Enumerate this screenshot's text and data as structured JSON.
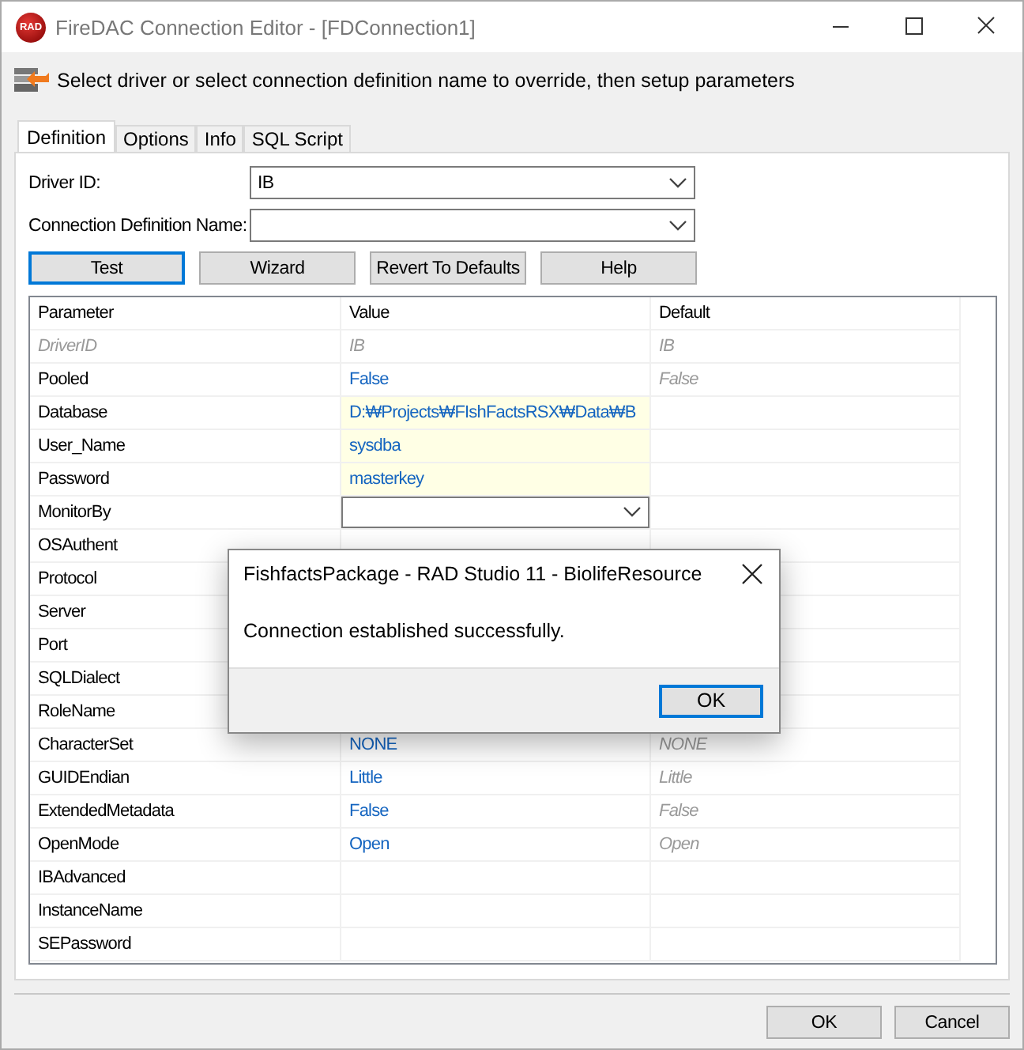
{
  "window": {
    "logo": "RAD",
    "title": "FireDAC Connection Editor - [FDConnection1]"
  },
  "header": {
    "text": "Select driver or select connection definition name to override, then setup parameters"
  },
  "tabs": [
    {
      "label": "Definition",
      "selected": true
    },
    {
      "label": "Options",
      "selected": false
    },
    {
      "label": "Info",
      "selected": false
    },
    {
      "label": "SQL Script",
      "selected": false
    }
  ],
  "fields": [
    {
      "label": "Driver ID:",
      "value": "IB"
    },
    {
      "label": "Connection Definition Name:"
    }
  ],
  "buttons": [
    {
      "label": "Test",
      "focused": true
    },
    {
      "label": "Wizard",
      "focused": false
    },
    {
      "label": "Revert To Defaults",
      "focused": false
    },
    {
      "label": "Help",
      "focused": false
    }
  ],
  "grid": {
    "columns": [
      "Parameter",
      "Value",
      "Default"
    ],
    "rows": [
      {
        "kind": "readonly",
        "name": "DriverID",
        "value": "IB",
        "default": "IB"
      },
      {
        "kind": "text",
        "name": "Pooled",
        "value": "False",
        "default": "False"
      },
      {
        "kind": "text",
        "name": "Database",
        "value": "D:₩Projects₩FIshFactsRSX₩Data₩B",
        "highlighted": true
      },
      {
        "kind": "text",
        "name": "User_Name",
        "value": "sysdba",
        "highlighted": true
      },
      {
        "kind": "text",
        "name": "Password",
        "value": "masterkey",
        "highlighted": true
      },
      {
        "kind": "combo",
        "name": "MonitorBy"
      },
      {
        "kind": "text",
        "name": "OSAuthent"
      },
      {
        "kind": "text",
        "name": "Protocol"
      },
      {
        "kind": "text",
        "name": "Server"
      },
      {
        "kind": "text",
        "name": "Port"
      },
      {
        "kind": "text",
        "name": "SQLDialect"
      },
      {
        "kind": "text",
        "name": "RoleName"
      },
      {
        "kind": "text",
        "name": "CharacterSet",
        "value": "NONE",
        "default": "NONE"
      },
      {
        "kind": "text",
        "name": "GUIDEndian",
        "value": "Little",
        "default": "Little"
      },
      {
        "kind": "text",
        "name": "ExtendedMetadata",
        "value": "False",
        "default": "False"
      },
      {
        "kind": "text",
        "name": "OpenMode",
        "value": "Open",
        "default": "Open"
      },
      {
        "kind": "text",
        "name": "IBAdvanced"
      },
      {
        "kind": "text",
        "name": "InstanceName"
      },
      {
        "kind": "text",
        "name": "SEPassword"
      }
    ]
  },
  "dialog": {
    "title": "FishfactsPackage - RAD Studio 11 - BiolifeResource",
    "message": "Connection established successfully.",
    "buttons": [
      {
        "label": "OK",
        "focused": true
      }
    ]
  },
  "footer_buttons": [
    {
      "label": "OK",
      "focused": false
    },
    {
      "label": "Cancel",
      "focused": false
    }
  ]
}
